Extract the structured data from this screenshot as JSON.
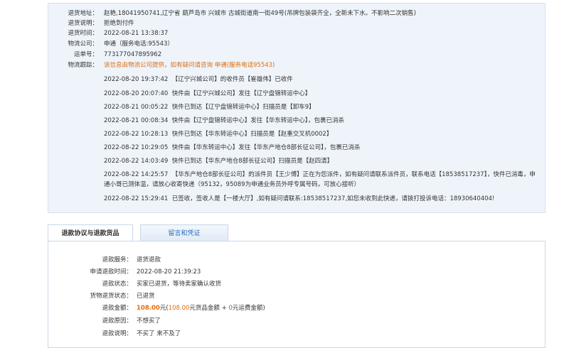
{
  "return_info": {
    "address_label": "退货地址：",
    "address_value": "赵艳,18041950741,辽宁省 葫芦岛市 兴城市 古城街道南一街49号(吊牌包装袋齐全，全新未下水。不影响二次销售)",
    "note_label": "退货说明：",
    "note_value": "拒绝到付件",
    "time_label": "退货时间：",
    "time_value": "2022-08-21 13:38:37",
    "carrier_label": "物流公司：",
    "carrier_value": "申通（服务电话:95543）",
    "tracking_label": "运单号：",
    "tracking_value": "773177047895962",
    "trace_label": "物流跟踪：",
    "trace_notice": "该信息由物流公司提供，如有疑问请咨询 申通(服务电话95543)"
  },
  "tracking_events": [
    {
      "time": "2022-08-20 19:37:42",
      "text": "【辽宁兴城公司】的收件员【崔雄伟】已收件"
    },
    {
      "time": "2022-08-20 20:07:40",
      "text": "快件由【辽宁兴城公司】发往【辽宁盘锦转运中心】"
    },
    {
      "time": "2022-08-21 00:05:22",
      "text": "快件已到达【辽宁盘锦转运中心】扫描员是【卸车9】"
    },
    {
      "time": "2022-08-21 00:08:34",
      "text": "快件由【辽宁盘锦转运中心】发往【华东转运中心】，包裹已消杀"
    },
    {
      "time": "2022-08-22 10:28:13",
      "text": "快件已到达【华东转运中心】扫描员是【赵重交叉机0002】"
    },
    {
      "time": "2022-08-22 10:29:05",
      "text": "快件由【华东转运中心】发往【华东产地仓8部长征公司】，包裹已消杀"
    },
    {
      "time": "2022-08-22 14:03:49",
      "text": "快件已到达【华东产地仓8部长征公司】扫描员是【赵四清】"
    },
    {
      "time": "2022-08-22 14:25:57",
      "text": "【华东产地仓8部长征公司】的派件员【王少博】正在为您派件，如有疑问请联系派件员，联系电话【18538517237】，快件已消毒，申通小哥已测体温，请放心收寄快递（95132，95089为申通业务员外呼专属号码，可放心接听）"
    },
    {
      "time": "2022-08-22 15:29:41",
      "text": "已签收，签收人是【一楼大厅】,如有疑问请联系:18538517237,如您未收到此快递，请拨打投诉电话：18930640404!"
    }
  ],
  "tabs": {
    "active": "退款协议与退款货品",
    "other": "留言和凭证"
  },
  "refund": {
    "service_label": "退款服务：",
    "service_value": "退货退款",
    "apply_time_label": "申请退款时间：",
    "apply_time_value": "2022-08-20 21:39:23",
    "status_label": "退款状态：",
    "status_value": "买家已退货，等待卖家确认收货",
    "goods_status_label": "货物退货状态：",
    "goods_status_value": "已退货",
    "amount_label": "退款金额：",
    "amount_total": "108.00",
    "amount_unit": "元",
    "amount_paren_open": "(",
    "amount_goods": "108.00",
    "amount_goods_text": "元货品金额 + ",
    "amount_ship": "0",
    "amount_ship_text": "元运费金额",
    "amount_paren_close": ")",
    "reason_label": "退款原因：",
    "reason_value": "不想买了",
    "desc_label": "退款说明：",
    "desc_value": "不买了 来不及了"
  },
  "colors": {
    "accent_orange": "#e46c0a",
    "link_blue": "#2a6ebb",
    "green": "#3a9a2a",
    "panel_bg": "#eef4fa"
  }
}
